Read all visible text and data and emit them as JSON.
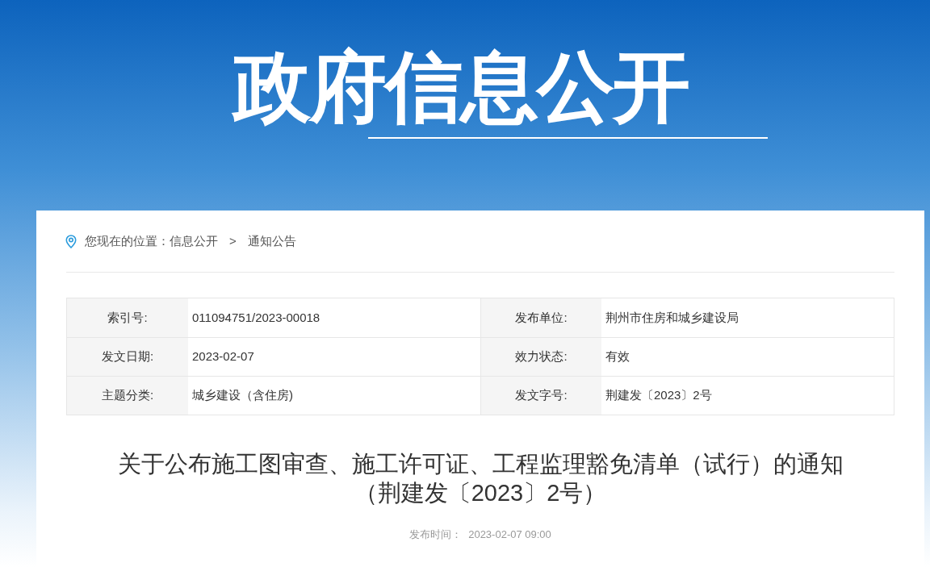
{
  "banner": {
    "title": "政府信息公开"
  },
  "breadcrumb": {
    "label": "您现在的位置：",
    "items": [
      "信息公开",
      "通知公告"
    ],
    "separator": ">"
  },
  "meta_rows": [
    [
      {
        "label": "索引号:",
        "value": "011094751/2023-00018"
      },
      {
        "label": "发布单位:",
        "value": "荆州市住房和城乡建设局"
      }
    ],
    [
      {
        "label": "发文日期:",
        "value": "2023-02-07"
      },
      {
        "label": "效力状态:",
        "value": "有效"
      }
    ],
    [
      {
        "label": "主题分类:",
        "value": "城乡建设（含住房)"
      },
      {
        "label": "发文字号:",
        "value": "荆建发〔2023〕2号"
      }
    ]
  ],
  "article": {
    "title_lines": [
      "关于公布施工图审查、施工许可证、工程监理豁免清单（试行）的通知",
      "（荆建发〔2023〕2号）"
    ],
    "publish_label": "发布时间：",
    "publish_time": "2023-02-07 09:00"
  }
}
